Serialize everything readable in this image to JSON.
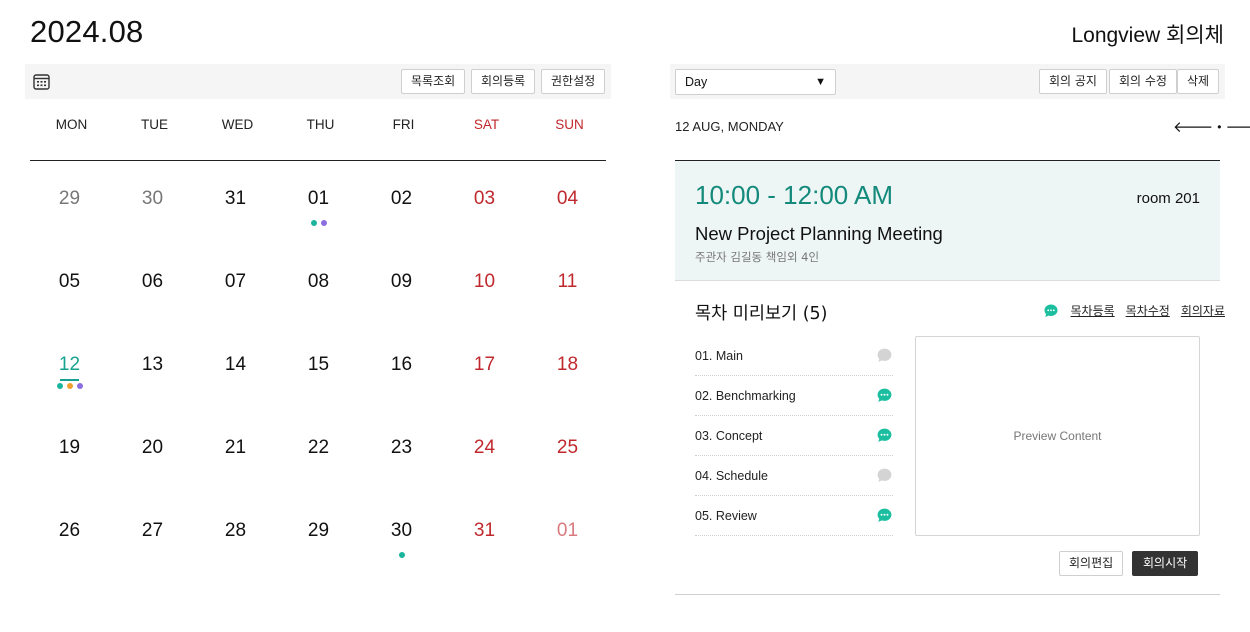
{
  "header": {
    "month": "2024.08",
    "brand": "Longview 회의체"
  },
  "calendar_toolbar": {
    "icon": "calendar-icon",
    "buttons": [
      "목록조회",
      "회의등록",
      "권한설정"
    ]
  },
  "weekdays": [
    "MON",
    "TUE",
    "WED",
    "THU",
    "FRI",
    "SAT",
    "SUN"
  ],
  "colors": {
    "weekend": "#c0282d",
    "accent": "#17a28f",
    "dot_teal": "#1bb59e",
    "dot_purple": "#8b6fe0",
    "dot_orange": "#f0a030",
    "chat_active": "#1bbfa0",
    "chat_inactive": "#d4d4d4"
  },
  "weeks": [
    [
      {
        "d": "29",
        "other": true
      },
      {
        "d": "30",
        "other": true
      },
      {
        "d": "31"
      },
      {
        "d": "01",
        "dots": [
          "teal",
          "purple"
        ]
      },
      {
        "d": "02"
      },
      {
        "d": "03"
      },
      {
        "d": "04"
      }
    ],
    [
      {
        "d": "05"
      },
      {
        "d": "06"
      },
      {
        "d": "07"
      },
      {
        "d": "08"
      },
      {
        "d": "09"
      },
      {
        "d": "10"
      },
      {
        "d": "11"
      }
    ],
    [
      {
        "d": "12",
        "today": true,
        "dots": [
          "teal",
          "orange",
          "purple"
        ]
      },
      {
        "d": "13"
      },
      {
        "d": "14"
      },
      {
        "d": "15"
      },
      {
        "d": "16"
      },
      {
        "d": "17"
      },
      {
        "d": "18"
      }
    ],
    [
      {
        "d": "19"
      },
      {
        "d": "20"
      },
      {
        "d": "21"
      },
      {
        "d": "22"
      },
      {
        "d": "23"
      },
      {
        "d": "24"
      },
      {
        "d": "25"
      }
    ],
    [
      {
        "d": "26"
      },
      {
        "d": "27"
      },
      {
        "d": "28"
      },
      {
        "d": "29"
      },
      {
        "d": "30",
        "dots": [
          "teal"
        ]
      },
      {
        "d": "31"
      },
      {
        "d": "01",
        "other": true
      }
    ]
  ],
  "detail_toolbar": {
    "view_select": "Day",
    "buttons": [
      "회의 공지",
      "회의 수정",
      "삭제"
    ]
  },
  "detail": {
    "date": "12 AUG, MONDAY",
    "time": "10:00 - 12:00 AM",
    "room": "room 201",
    "title": "New Project Planning Meeting",
    "subtitle": "주관자 김길동 책임외 4인"
  },
  "agenda": {
    "heading": "목차 미리보기 (5)",
    "links": [
      "목차등록",
      "목차수정",
      "회의자료"
    ],
    "items": [
      {
        "label": "01. Main",
        "active": false
      },
      {
        "label": "02. Benchmarking",
        "active": true
      },
      {
        "label": "03. Concept",
        "active": true
      },
      {
        "label": "04. Schedule",
        "active": false
      },
      {
        "label": "05. Review",
        "active": true
      }
    ],
    "preview": "Preview Content"
  },
  "actions": {
    "edit": "회의편집",
    "start": "회의시작"
  }
}
